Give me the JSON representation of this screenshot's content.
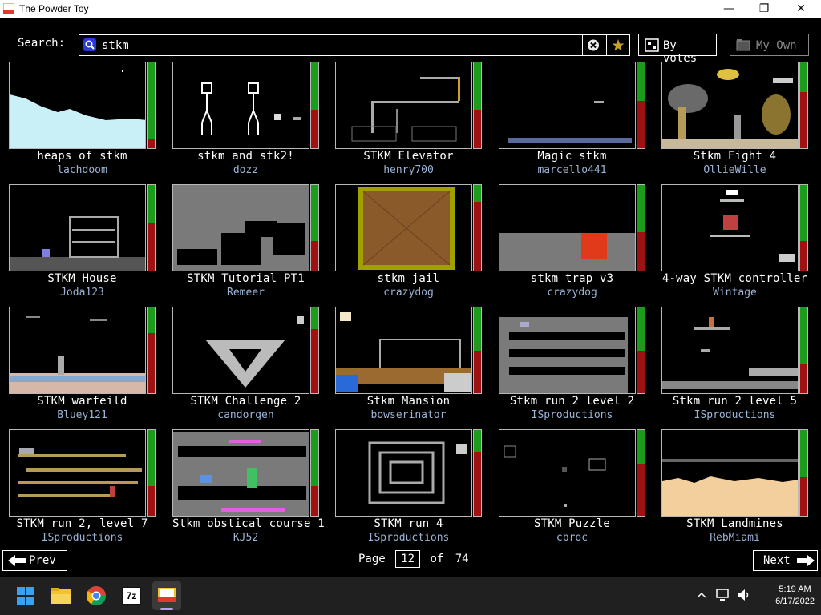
{
  "window": {
    "title": "The Powder Toy",
    "minimize": "—",
    "maximize": "❐",
    "close": "✕"
  },
  "search": {
    "label": "Search:",
    "query": "stkm",
    "clear_glyph": "⊗",
    "fav_glyph": "★"
  },
  "sort_button": {
    "label": "By votes",
    "icon": "sort-icon"
  },
  "my_own_button": {
    "label": "My Own",
    "icon": "folder-icon"
  },
  "saves": [
    {
      "title": "heaps of stkm",
      "author": "lachdoom",
      "score_up": 0.9
    },
    {
      "title": "stkm and stk2!",
      "author": "dozz",
      "score_up": 0.55
    },
    {
      "title": "STKM Elevator",
      "author": "henry700",
      "score_up": 0.55
    },
    {
      "title": "Magic stkm",
      "author": "marcello441",
      "score_up": 0.45
    },
    {
      "title": "Stkm Fight 4",
      "author": "OllieWille",
      "score_up": 0.35
    },
    {
      "title": "STKM House",
      "author": "Joda123",
      "score_up": 0.45
    },
    {
      "title": "STKM Tutorial PT1",
      "author": "Remeer",
      "score_up": 0.65
    },
    {
      "title": "stkm jail",
      "author": "crazydog",
      "score_up": 0.2
    },
    {
      "title": "stkm trap v3",
      "author": "crazydog",
      "score_up": 0.55
    },
    {
      "title": "4-way STKM controller",
      "author": "Wintage",
      "score_up": 0.65
    },
    {
      "title": "STKM warfeild",
      "author": "Bluey121",
      "score_up": 0.3
    },
    {
      "title": "STKM Challenge 2",
      "author": "candorgen",
      "score_up": 0.25
    },
    {
      "title": "Stkm Mansion",
      "author": "bowserinator",
      "score_up": 0.5
    },
    {
      "title": "Stkm run 2 level 2",
      "author": "ISproductions",
      "score_up": 0.5
    },
    {
      "title": "Stkm run 2 level 5",
      "author": "ISproductions",
      "score_up": 0.65
    },
    {
      "title": "STKM run 2, level 7",
      "author": "ISproductions",
      "score_up": 0.65
    },
    {
      "title": "Stkm obstical course 1",
      "author": "KJ52",
      "score_up": 0.65
    },
    {
      "title": "STKM run 4",
      "author": "ISproductions",
      "score_up": 0.25
    },
    {
      "title": "STKM Puzzle",
      "author": "cbroc",
      "score_up": 0.4
    },
    {
      "title": "STKM Landmines",
      "author": "RebMiami",
      "score_up": 0.55
    }
  ],
  "pagination": {
    "prev_label": "Prev",
    "next_label": "Next",
    "page_word": "Page",
    "current_page": "12",
    "of_word": "of",
    "total_pages": "74"
  },
  "taskbar": {
    "apps": [
      "start-icon",
      "file-explorer-icon",
      "chrome-icon",
      "7zip-icon",
      "powder-toy-icon"
    ],
    "sevenzip_text": "7z",
    "time": "5:19 AM",
    "date": "6/17/2022"
  },
  "colors": {
    "author": "#9cb3d6",
    "vote_up": "#1b9d1b",
    "vote_down": "#a01212",
    "taskbar": "#202020"
  }
}
